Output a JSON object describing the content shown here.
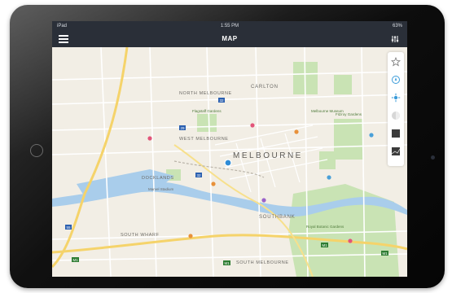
{
  "status_bar": {
    "carrier": "iPad",
    "time": "1:55 PM",
    "battery": "63%"
  },
  "navbar": {
    "title": "MAP"
  },
  "map": {
    "city_label": "MELBOURNE",
    "districts": [
      "CARLTON",
      "NORTH MELBOURNE",
      "WEST MELBOURNE",
      "DOCKLANDS",
      "SOUTHBANK",
      "SOUTH WHARF",
      "SOUTH MELBOURNE"
    ],
    "poi_labels": [
      "Melbourne Museum",
      "Flagstaff Gardens",
      "Fitzroy Gardens",
      "Royal Botanic Gardens",
      "Marvel Stadium"
    ],
    "road_badges": [
      "M1",
      "M1",
      "M1",
      "M1",
      "32",
      "32",
      "29",
      "55"
    ]
  },
  "side_panel": {
    "items": [
      "star-icon",
      "compass-icon",
      "locate-icon",
      "layers-icon",
      "satellite-icon",
      "hybrid-icon"
    ]
  }
}
